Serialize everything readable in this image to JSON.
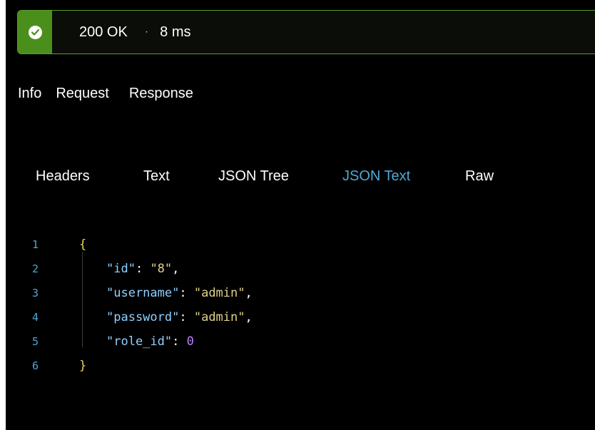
{
  "status": {
    "code_text": "200 OK",
    "separator": "·",
    "time": "8 ms",
    "icon": "check-circle-icon",
    "color": "#4a8f1c"
  },
  "main_tabs": [
    "Info",
    "Request",
    "Response"
  ],
  "sub_tabs": [
    "Headers",
    "Text",
    "JSON Tree",
    "JSON Text",
    "Raw"
  ],
  "active_sub_tab": "JSON Text",
  "colors": {
    "accent": "#4fa8d6",
    "json_key": "#8fd1ff",
    "json_string": "#ded28a",
    "json_number": "#b680f5"
  },
  "code": {
    "line_numbers": [
      "1",
      "2",
      "3",
      "4",
      "5",
      "6"
    ],
    "open_brace": "{",
    "close_brace": "}",
    "fields": [
      {
        "key": "\"id\"",
        "value": "\"8\""
      },
      {
        "key": "\"username\"",
        "value": "\"admin\""
      },
      {
        "key": "\"password\"",
        "value": "\"admin\""
      },
      {
        "key": "\"role_id\"",
        "value": "0"
      }
    ]
  }
}
